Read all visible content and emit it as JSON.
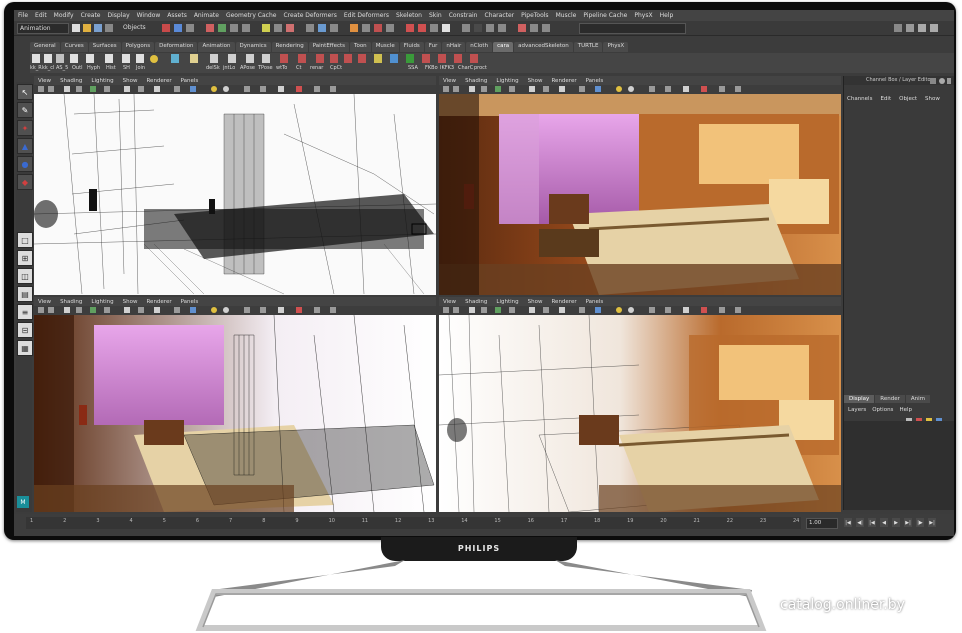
{
  "menubar": [
    "File",
    "Edit",
    "Modify",
    "Create",
    "Display",
    "Window",
    "Assets",
    "Animate",
    "Geometry Cache",
    "Create Deformers",
    "Edit Deformers",
    "Skeleton",
    "Skin",
    "Constrain",
    "Character",
    "PipeTools",
    "Muscle",
    "Pipeline Cache",
    "PhysX",
    "Help"
  ],
  "statusline": {
    "mode": "Animation",
    "objects_label": "Objects"
  },
  "shelf_tabs": [
    "General",
    "Curves",
    "Surfaces",
    "Polygons",
    "Deformation",
    "Animation",
    "Dynamics",
    "Rendering",
    "PaintEffects",
    "Toon",
    "Muscle",
    "Fluids",
    "Fur",
    "nHair",
    "nCloth",
    "cara",
    "advancedSkeleton",
    "TURTLE",
    "PhysX"
  ],
  "shelf_active_tab": "cara",
  "shelf_icon_labels": [
    "kk_R",
    "kk_cl",
    "AS_5",
    "Outl",
    "Hyph",
    "Hist",
    "SH",
    "Join",
    "delSk",
    "jntLo",
    "APose",
    "TPose",
    "wtTo",
    "Ct",
    "renar",
    "CpCt",
    "SSA",
    "FKBo",
    "IKFK3",
    "CharC",
    "proct"
  ],
  "viewport_menu": [
    "View",
    "Shading",
    "Lighting",
    "Show",
    "Renderer",
    "Panels"
  ],
  "channel_box": {
    "header": "Channel Box / Layer Editor",
    "menu": [
      "Channels",
      "Edit",
      "Object",
      "Show"
    ],
    "layer_tabs": [
      "Display",
      "Render",
      "Anim"
    ],
    "layer_active_tab": "Display",
    "layer_menu": [
      "Layers",
      "Options",
      "Help"
    ]
  },
  "timeline": {
    "ticks": [
      "1",
      "2",
      "3",
      "4",
      "5",
      "6",
      "7",
      "8",
      "9",
      "10",
      "11",
      "12",
      "13",
      "14",
      "15",
      "16",
      "17",
      "18",
      "19",
      "20",
      "21",
      "22",
      "23",
      "24"
    ],
    "current_time": "1.00"
  },
  "monitor": {
    "brand": "PHILIPS"
  },
  "watermark": "catalog.onliner.by",
  "colors": {
    "bezel": "#0c0c0c",
    "maya_ui": "#3c3c3c",
    "room_pink": "#c784c9",
    "room_wood": "#a9531f",
    "bed_cream": "#e6d2a6"
  }
}
